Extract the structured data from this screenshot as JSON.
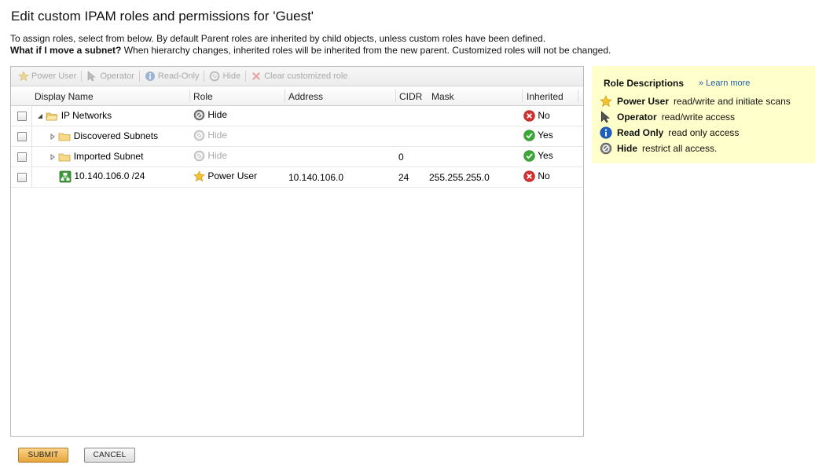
{
  "page": {
    "title": "Edit custom IPAM roles and permissions for 'Guest'",
    "intro_line1": "To assign roles, select from below. By default Parent roles are inherited by child objects, unless custom roles have been defined.",
    "intro_line2_bold": "What if I move a subnet?",
    "intro_line2_rest": " When hierarchy changes, inherited roles will be inherited from the new parent. Customized roles will not be changed."
  },
  "toolbar": {
    "power_user": "Power User",
    "operator": "Operator",
    "read_only": "Read-Only",
    "hide": "Hide",
    "clear": "Clear customized role"
  },
  "columns": {
    "display_name": "Display Name",
    "role": "Role",
    "address": "Address",
    "cidr": "CIDR",
    "mask": "Mask",
    "inherited": "Inherited"
  },
  "rows": [
    {
      "name": "IP Networks",
      "role": "Hide",
      "address": "",
      "cidr": "",
      "mask": "",
      "inherited": "No"
    },
    {
      "name": "Discovered Subnets",
      "role": "Hide",
      "address": "",
      "cidr": "",
      "mask": "",
      "inherited": "Yes"
    },
    {
      "name": "Imported Subnet",
      "role": "Hide",
      "address": "",
      "cidr": "0",
      "mask": "",
      "inherited": "Yes"
    },
    {
      "name": "10.140.106.0 /24",
      "role": "Power User",
      "address": "10.140.106.0",
      "cidr": "24",
      "mask": "255.255.255.0",
      "inherited": "No"
    }
  ],
  "role_descriptions": {
    "title": "Role Descriptions",
    "learn_more": "» Learn more",
    "items": [
      {
        "name": "Power User",
        "desc": "read/write and initiate scans"
      },
      {
        "name": "Operator",
        "desc": "read/write access"
      },
      {
        "name": "Read Only",
        "desc": "read only access"
      },
      {
        "name": "Hide",
        "desc": "restrict all access."
      }
    ]
  },
  "buttons": {
    "submit": "SUBMIT",
    "cancel": "CANCEL"
  },
  "colors": {
    "panel_bg": "#ffffcc",
    "link": "#1f5fa8",
    "no_red": "#d43030",
    "yes_green": "#3aa935"
  }
}
